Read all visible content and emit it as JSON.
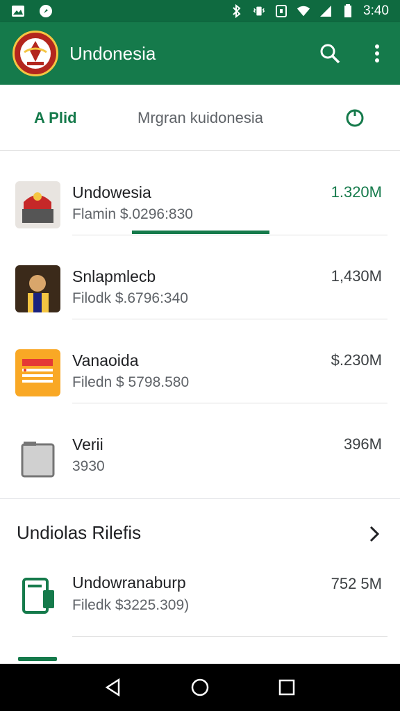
{
  "status_bar": {
    "time": "3:40"
  },
  "app_bar": {
    "title": "Undonesia"
  },
  "tabs": [
    {
      "label": "A Plid"
    },
    {
      "label": "Mrgran kuidonesia"
    }
  ],
  "items": [
    {
      "title": "Undowesia",
      "subtitle": "Flamin $.0296:830",
      "size": "1.320M"
    },
    {
      "title": "Snlapmlecb",
      "subtitle": "Filodk $.6796:340",
      "size": "1,430M"
    },
    {
      "title": "Vanaoida",
      "subtitle": "Filedn $ 5798.580",
      "size": "$.230M"
    },
    {
      "title": "Verii",
      "subtitle": "3930",
      "size": "396M"
    }
  ],
  "section": {
    "title": "Undiolas Rilefis",
    "items": [
      {
        "title": "Undowranaburp",
        "subtitle": "Filedk $3225.309)",
        "size": "752 5M"
      }
    ]
  },
  "colors": {
    "primary": "#157a4b",
    "status_bar": "#0f6a40"
  }
}
